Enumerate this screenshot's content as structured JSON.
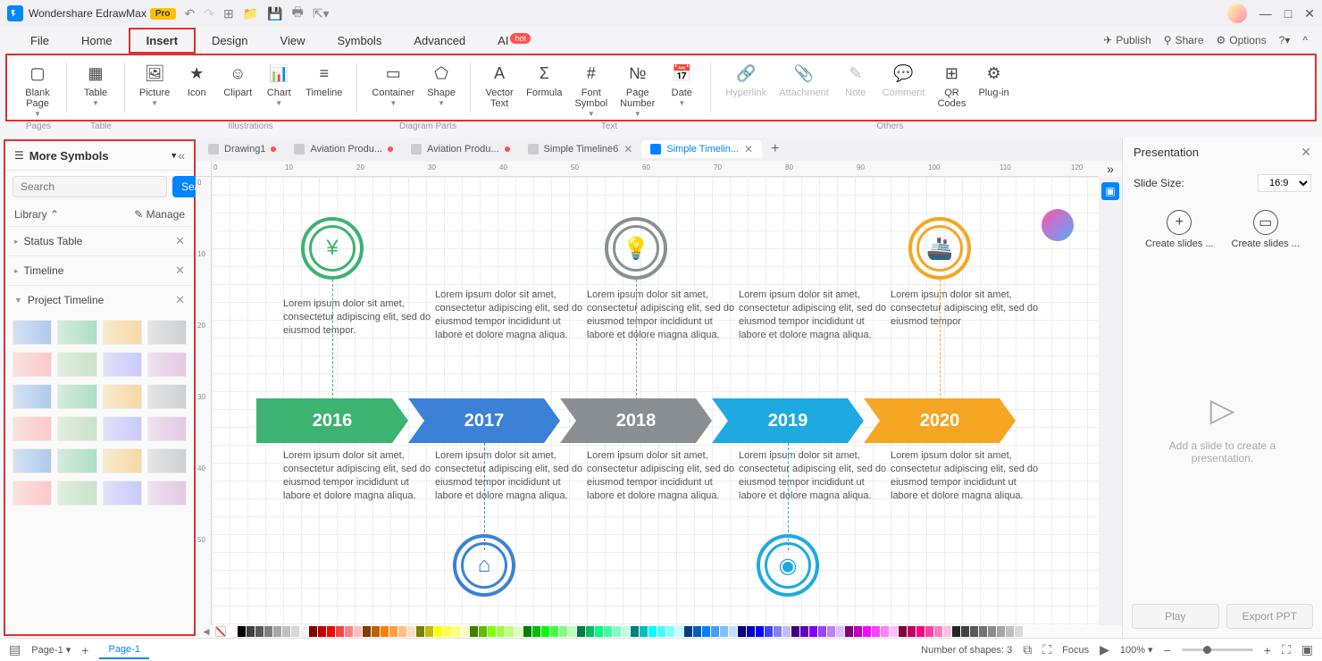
{
  "app": {
    "name": "Wondershare EdrawMax",
    "badge": "Pro"
  },
  "window": {
    "minimize": "—",
    "maximize": "□",
    "close": "✕"
  },
  "menu": {
    "items": [
      "File",
      "Home",
      "Insert",
      "Design",
      "View",
      "Symbols",
      "Advanced",
      "AI"
    ],
    "active": "Insert",
    "ai_badge": "hot",
    "right": {
      "publish": "Publish",
      "share": "Share",
      "options": "Options"
    }
  },
  "ribbon": {
    "groups": {
      "pages": [
        {
          "id": "blank-page",
          "label": "Blank\nPage",
          "caret": true
        }
      ],
      "table": [
        {
          "id": "table",
          "label": "Table",
          "caret": true
        }
      ],
      "illus": [
        {
          "id": "picture",
          "label": "Picture",
          "caret": true
        },
        {
          "id": "icon",
          "label": "Icon"
        },
        {
          "id": "clipart",
          "label": "Clipart"
        },
        {
          "id": "chart",
          "label": "Chart",
          "caret": true
        },
        {
          "id": "timeline",
          "label": "Timeline"
        }
      ],
      "diagram": [
        {
          "id": "container",
          "label": "Container",
          "caret": true
        },
        {
          "id": "shape",
          "label": "Shape",
          "caret": true
        }
      ],
      "text": [
        {
          "id": "vector-text",
          "label": "Vector\nText"
        },
        {
          "id": "formula",
          "label": "Formula"
        },
        {
          "id": "font-symbol",
          "label": "Font\nSymbol",
          "caret": true
        },
        {
          "id": "page-number",
          "label": "Page\nNumber",
          "caret": true
        },
        {
          "id": "date",
          "label": "Date",
          "caret": true
        }
      ],
      "others": [
        {
          "id": "hyperlink",
          "label": "Hyperlink",
          "disabled": true
        },
        {
          "id": "attachment",
          "label": "Attachment",
          "disabled": true
        },
        {
          "id": "note",
          "label": "Note",
          "disabled": true
        },
        {
          "id": "comment",
          "label": "Comment",
          "disabled": true
        },
        {
          "id": "qr-codes",
          "label": "QR\nCodes"
        },
        {
          "id": "plugin",
          "label": "Plug-in"
        }
      ]
    },
    "labels": {
      "pages": "Pages",
      "table": "Table",
      "illus": "Illustrations",
      "diagram": "Diagram Parts",
      "text": "Text",
      "others": "Others"
    }
  },
  "left": {
    "title": "More Symbols",
    "search_placeholder": "Search",
    "search_btn": "Search",
    "library": "Library",
    "manage": "Manage",
    "cats": [
      {
        "name": "Status Table",
        "open": false
      },
      {
        "name": "Timeline",
        "open": false
      },
      {
        "name": "Project Timeline",
        "open": true
      }
    ]
  },
  "doctabs": [
    {
      "label": "Drawing1",
      "dirty": true
    },
    {
      "label": "Aviation Produ...",
      "dirty": true
    },
    {
      "label": "Aviation Produ...",
      "dirty": true
    },
    {
      "label": "Simple Timeline6",
      "dirty": false,
      "closable": true
    },
    {
      "label": "Simple Timelin...",
      "dirty": false,
      "active": true,
      "closable": true
    }
  ],
  "ruler_h": [
    "0",
    "10",
    "20",
    "30",
    "40",
    "50",
    "60",
    "70",
    "80",
    "90",
    "100",
    "110",
    "120"
  ],
  "ruler_v": [
    "0",
    "10",
    "20",
    "30",
    "40",
    "50"
  ],
  "timeline": {
    "lorem_long": "Lorem ipsum dolor sit amet, consectetur adipiscing elit, sed do eiusmod tempor incididunt ut labore et dolore magna aliqua.",
    "lorem_short": "Lorem ipsum dolor sit amet, consectetur adipiscing elit, sed do eiusmod tempor",
    "items": [
      {
        "year": "2016",
        "color": "#3cb371"
      },
      {
        "year": "2017",
        "color": "#3b82d6"
      },
      {
        "year": "2018",
        "color": "#8a8f94"
      },
      {
        "year": "2019",
        "color": "#1eaae0"
      },
      {
        "year": "2020",
        "color": "#f5a623"
      }
    ]
  },
  "presentation": {
    "title": "Presentation",
    "slide_size": "Slide Size:",
    "ratio": "16:9",
    "create1": "Create slides ...",
    "create2": "Create slides ...",
    "empty": "Add a slide to create a presentation.",
    "play": "Play",
    "export": "Export PPT"
  },
  "status": {
    "page": "Page-1",
    "page_tab": "Page-1",
    "shapes": "Number of shapes: 3",
    "focus": "Focus",
    "zoom": "100%"
  },
  "colors": [
    "#fff",
    "#000",
    "#404040",
    "#595959",
    "#7f7f7f",
    "#a5a5a5",
    "#bfbfbf",
    "#d8d8d8",
    "#f2f2f2",
    "#7f0000",
    "#c00000",
    "#ff0000",
    "#ff4040",
    "#ff8080",
    "#ffbfbf",
    "#7f3f00",
    "#bf5f00",
    "#ff7f00",
    "#ff9f40",
    "#ffbf80",
    "#ffdfbf",
    "#7f7f00",
    "#bfbf00",
    "#ffff00",
    "#ffff40",
    "#ffff80",
    "#ffffbf",
    "#3f7f00",
    "#5fbf00",
    "#7fff00",
    "#9fff40",
    "#bfff80",
    "#dfffbf",
    "#007f00",
    "#00bf00",
    "#00ff00",
    "#40ff40",
    "#80ff80",
    "#bfffbf",
    "#007f3f",
    "#00bf5f",
    "#00ff7f",
    "#40ff9f",
    "#80ffbf",
    "#bfffdf",
    "#007f7f",
    "#00bfbf",
    "#00ffff",
    "#40ffff",
    "#80ffff",
    "#bfffff",
    "#003f7f",
    "#005fbf",
    "#007fff",
    "#409fff",
    "#80bfff",
    "#bfdfff",
    "#00007f",
    "#0000bf",
    "#0000ff",
    "#4040ff",
    "#8080ff",
    "#bfbfff",
    "#3f007f",
    "#5f00bf",
    "#7f00ff",
    "#9f40ff",
    "#bf80ff",
    "#dfbfff",
    "#7f007f",
    "#bf00bf",
    "#ff00ff",
    "#ff40ff",
    "#ff80ff",
    "#ffbfff",
    "#7f003f",
    "#bf005f",
    "#ff007f",
    "#ff409f",
    "#ff80bf",
    "#ffbfdf",
    "#262626",
    "#404040",
    "#595959",
    "#737373",
    "#8c8c8c",
    "#a6a6a6",
    "#bfbfbf",
    "#d9d9d9"
  ]
}
